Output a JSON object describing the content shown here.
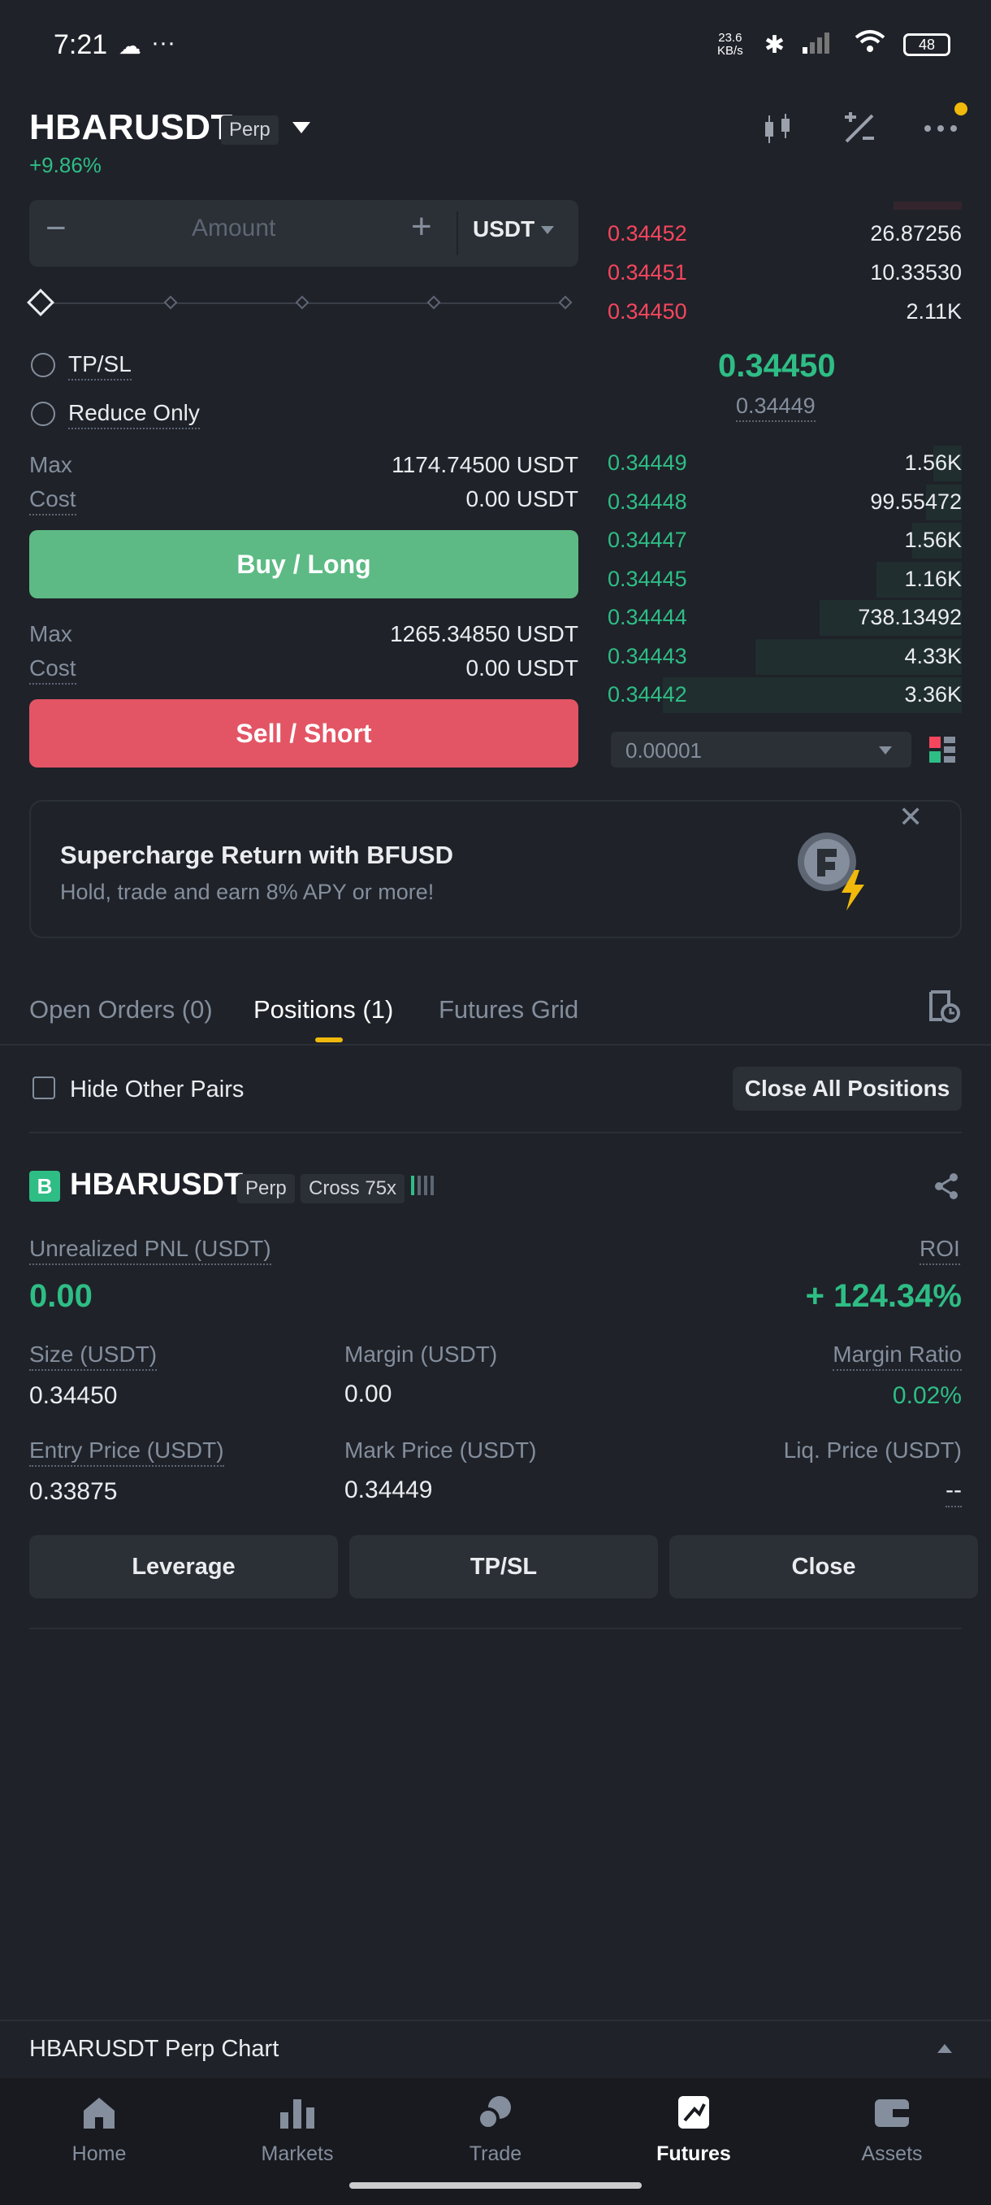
{
  "status_bar": {
    "time": "7:21",
    "net_speed": "23.6 KB/s",
    "battery": "48"
  },
  "header": {
    "pair": "HBARUSDT",
    "type_tag": "Perp",
    "change": "+9.86%"
  },
  "order_form": {
    "amount_placeholder": "Amount",
    "minus": "−",
    "plus": "+",
    "unit": "USDT",
    "tpsl_label": "TP/SL",
    "reduce_only_label": "Reduce Only",
    "buy": {
      "max_label": "Max",
      "max_value": "1174.74500 USDT",
      "cost_label": "Cost",
      "cost_value": "0.00 USDT",
      "button": "Buy / Long"
    },
    "sell": {
      "max_label": "Max",
      "max_value": "1265.34850 USDT",
      "cost_label": "Cost",
      "cost_value": "0.00 USDT",
      "button": "Sell / Short"
    }
  },
  "order_book": {
    "asks": [
      {
        "price": "0.34452",
        "qty": "26.87256"
      },
      {
        "price": "0.34451",
        "qty": "10.33530"
      },
      {
        "price": "0.34450",
        "qty": "2.11K"
      }
    ],
    "last_price": "0.34450",
    "mark_price": "0.34449",
    "bids": [
      {
        "price": "0.34449",
        "qty": "1.56K",
        "depth": 0.08
      },
      {
        "price": "0.34448",
        "qty": "99.55472",
        "depth": 0.1
      },
      {
        "price": "0.34447",
        "qty": "1.56K",
        "depth": 0.14
      },
      {
        "price": "0.34445",
        "qty": "1.16K",
        "depth": 0.24
      },
      {
        "price": "0.34444",
        "qty": "738.13492",
        "depth": 0.4
      },
      {
        "price": "0.34443",
        "qty": "4.33K",
        "depth": 0.58
      },
      {
        "price": "0.34442",
        "qty": "3.36K",
        "depth": 0.84
      }
    ],
    "tick_size": "0.00001"
  },
  "promo": {
    "title": "Supercharge Return with BFUSD",
    "subtitle": "Hold, trade and earn 8% APY or more!"
  },
  "tabs": {
    "open_orders": "Open Orders (0)",
    "positions": "Positions (1)",
    "futures_grid": "Futures Grid"
  },
  "positions": {
    "hide_other_pairs": "Hide Other Pairs",
    "close_all": "Close All Positions",
    "item": {
      "side_badge": "B",
      "pair": "HBARUSDT",
      "type_tag": "Perp",
      "margin_tag": "Cross 75x",
      "unrealized_pnl_label": "Unrealized PNL (USDT)",
      "unrealized_pnl": "0.00",
      "roi_label": "ROI",
      "roi": "+ 124.34%",
      "size_label": "Size (USDT)",
      "size": "0.34450",
      "margin_label": "Margin (USDT)",
      "margin": "0.00",
      "margin_ratio_label": "Margin Ratio",
      "margin_ratio": "0.02%",
      "entry_price_label": "Entry Price (USDT)",
      "entry_price": "0.33875",
      "mark_price_label": "Mark Price (USDT)",
      "mark_price": "0.34449",
      "liq_price_label": "Liq. Price (USDT)",
      "liq_price": "--",
      "buttons": {
        "leverage": "Leverage",
        "tpsl": "TP/SL",
        "close": "Close"
      }
    }
  },
  "chart_bar": {
    "label": "HBARUSDT Perp Chart"
  },
  "nav": {
    "items": [
      {
        "label": "Home",
        "active": false
      },
      {
        "label": "Markets",
        "active": false
      },
      {
        "label": "Trade",
        "active": false
      },
      {
        "label": "Futures",
        "active": true
      },
      {
        "label": "Assets",
        "active": false
      }
    ]
  },
  "colors": {
    "green": "#2ebd85",
    "red": "#f6465d",
    "accent": "#f0b90b",
    "bg": "#1f2229"
  }
}
